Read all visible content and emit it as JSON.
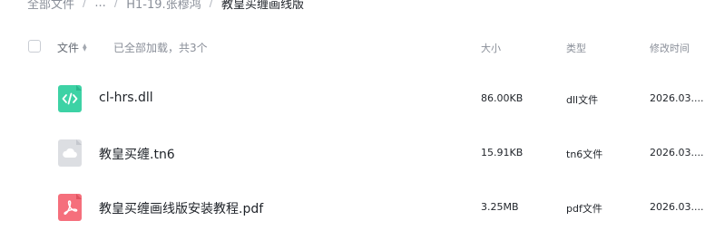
{
  "breadcrumb": {
    "items": [
      "全部文件",
      "...",
      "H1-19.张穆鸿",
      "教皇买缠画线版"
    ],
    "separator": "/"
  },
  "header": {
    "file_column": "文件",
    "load_status": "已全部加载，共3个",
    "size_column": "大小",
    "type_column": "类型",
    "modified_column": "修改时间",
    "sort_icon": "sort-icon"
  },
  "files": [
    {
      "name": "cl-hrs.dll",
      "size": "86.00KB",
      "type": "dll文件",
      "modified": "2026.03....",
      "icon": "code-file-icon",
      "icon_color": "#3dd2a5"
    },
    {
      "name": "教皇买缠.tn6",
      "size": "15.91KB",
      "type": "tn6文件",
      "modified": "2026.03....",
      "icon": "cloud-file-icon",
      "icon_color": "#dcdee2"
    },
    {
      "name": "教皇买缠画线版安装教程.pdf",
      "size": "3.25MB",
      "type": "pdf文件",
      "modified": "2026.03....",
      "icon": "pdf-file-icon",
      "icon_color": "#f56f7c"
    }
  ]
}
